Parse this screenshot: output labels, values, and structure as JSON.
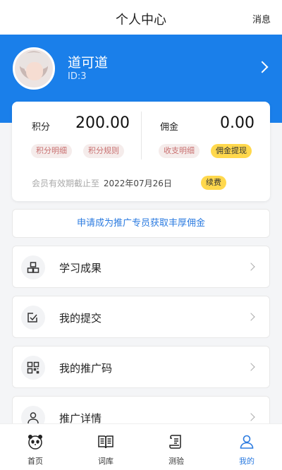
{
  "header": {
    "title": "个人中心",
    "message_label": "消息"
  },
  "profile": {
    "name": "道可道",
    "id_text": "ID:3",
    "avatar": "user-avatar"
  },
  "stats": {
    "points_label": "积分",
    "points_value": "200.00",
    "points_detail": "积分明细",
    "points_rules": "积分规则",
    "commission_label": "佣金",
    "commission_value": "0.00",
    "income_detail": "收支明细",
    "withdraw": "佣金提现",
    "membership_text": "会员有效期截止至",
    "membership_date": "2022年07月26日",
    "renew": "续费"
  },
  "promo": {
    "text": "申请成为推广专员获取丰厚佣金"
  },
  "menu": [
    {
      "label": "学习成果",
      "icon": "blocks-icon"
    },
    {
      "label": "我的提交",
      "icon": "edit-check-icon"
    },
    {
      "label": "我的推广码",
      "icon": "qr-code-icon"
    },
    {
      "label": "推广详情",
      "icon": "user-icon"
    }
  ],
  "tabs": [
    {
      "label": "首页",
      "icon": "panda-icon"
    },
    {
      "label": "词库",
      "icon": "book-icon"
    },
    {
      "label": "测验",
      "icon": "scroll-icon"
    },
    {
      "label": "我的",
      "icon": "person-icon",
      "active": true
    }
  ],
  "colors": {
    "primary": "#1a7fea",
    "accent_yellow": "#ffd84d",
    "link_blue": "#2b7be0"
  }
}
